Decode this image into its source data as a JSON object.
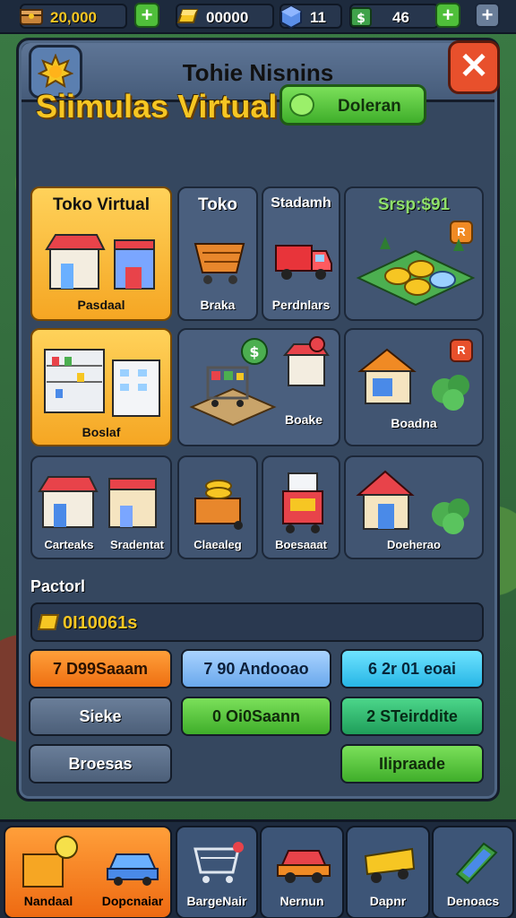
{
  "topbar": {
    "coins": "20,000",
    "gems": "00000",
    "cubes": "11",
    "cash": "46"
  },
  "panel": {
    "title": "Tohie Nisnins",
    "close_label": "✕",
    "sim_title": "Siimulas Virtual",
    "deliver_label": "Doleran"
  },
  "tiles": {
    "toko_virtual": {
      "title": "Toko Virtual",
      "label": "Pasdaal"
    },
    "toko": {
      "title": "Toko",
      "label": "Braka"
    },
    "stadamh": {
      "title": "Stadamh",
      "label": "Perdnlars"
    },
    "srsp": {
      "title": "Srsp:$91",
      "badge": "R"
    },
    "warehouse": {
      "label": "Boslaf"
    },
    "cart": {
      "badge": "$"
    },
    "store_red": {
      "label": "Boake",
      "badge": "$"
    },
    "house": {
      "label": "Boadna",
      "badge": "R"
    },
    "pair": {
      "label_a": "Carteaks",
      "label_b": "Sradentat"
    },
    "coins": {
      "label": "Claealeg"
    },
    "machine": {
      "label": "Boesaaat"
    },
    "barn": {
      "label": "Doeherao"
    }
  },
  "section": {
    "label": "Pactorl",
    "code": "0I10061s"
  },
  "actions": [
    {
      "label": "7 D99Saaam"
    },
    {
      "label": "7 90 Andooao"
    },
    {
      "label": "6 2r 01 eoai"
    },
    {
      "label": "Sieke"
    },
    {
      "label": "0 Oi0Saann"
    },
    {
      "label": "2 STeirddite"
    },
    {
      "label": "Broesas"
    },
    {
      "label": "Ilipraade"
    }
  ],
  "nav": [
    {
      "label": "Nandaal"
    },
    {
      "label": "Dopcnaiar"
    },
    {
      "label": "BargeNair"
    },
    {
      "label": "Nernun"
    },
    {
      "label": "Dapnr"
    },
    {
      "label": "Denoacs"
    }
  ]
}
